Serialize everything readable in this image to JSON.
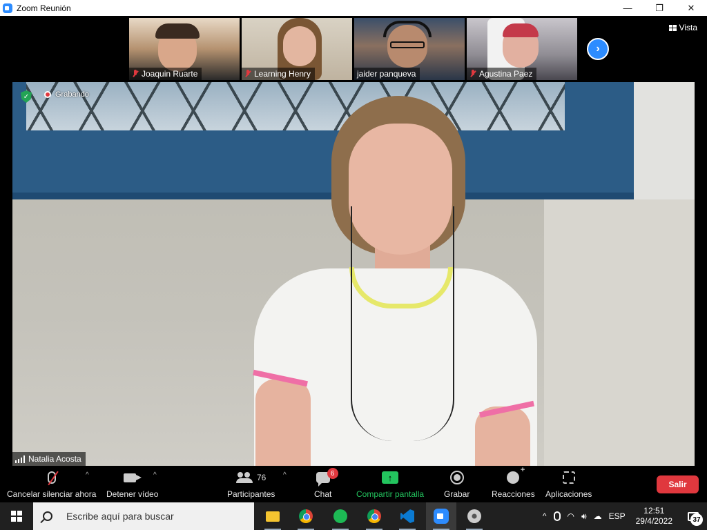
{
  "window": {
    "title": "Zoom Reunión",
    "minimize": "—",
    "maximize": "❐",
    "close": "✕"
  },
  "gallery": {
    "participants": [
      {
        "name": "Joaquin Ruarte",
        "muted": true,
        "bg": "#b59270"
      },
      {
        "name": "Learning Henry",
        "muted": true,
        "bg": "#b8a48a"
      },
      {
        "name": "jaider panqueva",
        "muted": false,
        "bg": "#556677"
      },
      {
        "name": "Agustina Paez",
        "muted": true,
        "bg": "#8f8c93"
      }
    ],
    "next_arrow": "›",
    "view_label": "Vista"
  },
  "main_video": {
    "speaker_name": "Natalia Acosta",
    "recording_label": "Grabando",
    "secure_check": "✓"
  },
  "toolbar": {
    "mute_label": "Cancelar silenciar ahora",
    "video_label": "Detener vídeo",
    "participants_label": "Participantes",
    "participants_count": "76",
    "chat_label": "Chat",
    "chat_badge": "6",
    "share_label": "Compartir pantalla",
    "share_arrow": "↑",
    "record_label": "Grabar",
    "reactions_label": "Reacciones",
    "apps_label": "Aplicaciones",
    "leave_label": "Salir",
    "caret": "^"
  },
  "taskbar": {
    "search_placeholder": "Escribe aquí para buscar",
    "apps": [
      "file-explorer",
      "chrome",
      "spotify",
      "chrome-profile",
      "vscode",
      "zoom",
      "media-player"
    ],
    "tray": {
      "chevron": "^",
      "language": "ESP",
      "time": "12:51",
      "date": "29/4/2022",
      "notifications_count": "37",
      "volume": "🔊︎",
      "wifi": "◠",
      "cloud": "☁"
    }
  },
  "colors": {
    "zoom_blue": "#2d8cff",
    "leave_red": "#e0383e",
    "share_green": "#23c45e",
    "secure_green": "#23a455"
  }
}
